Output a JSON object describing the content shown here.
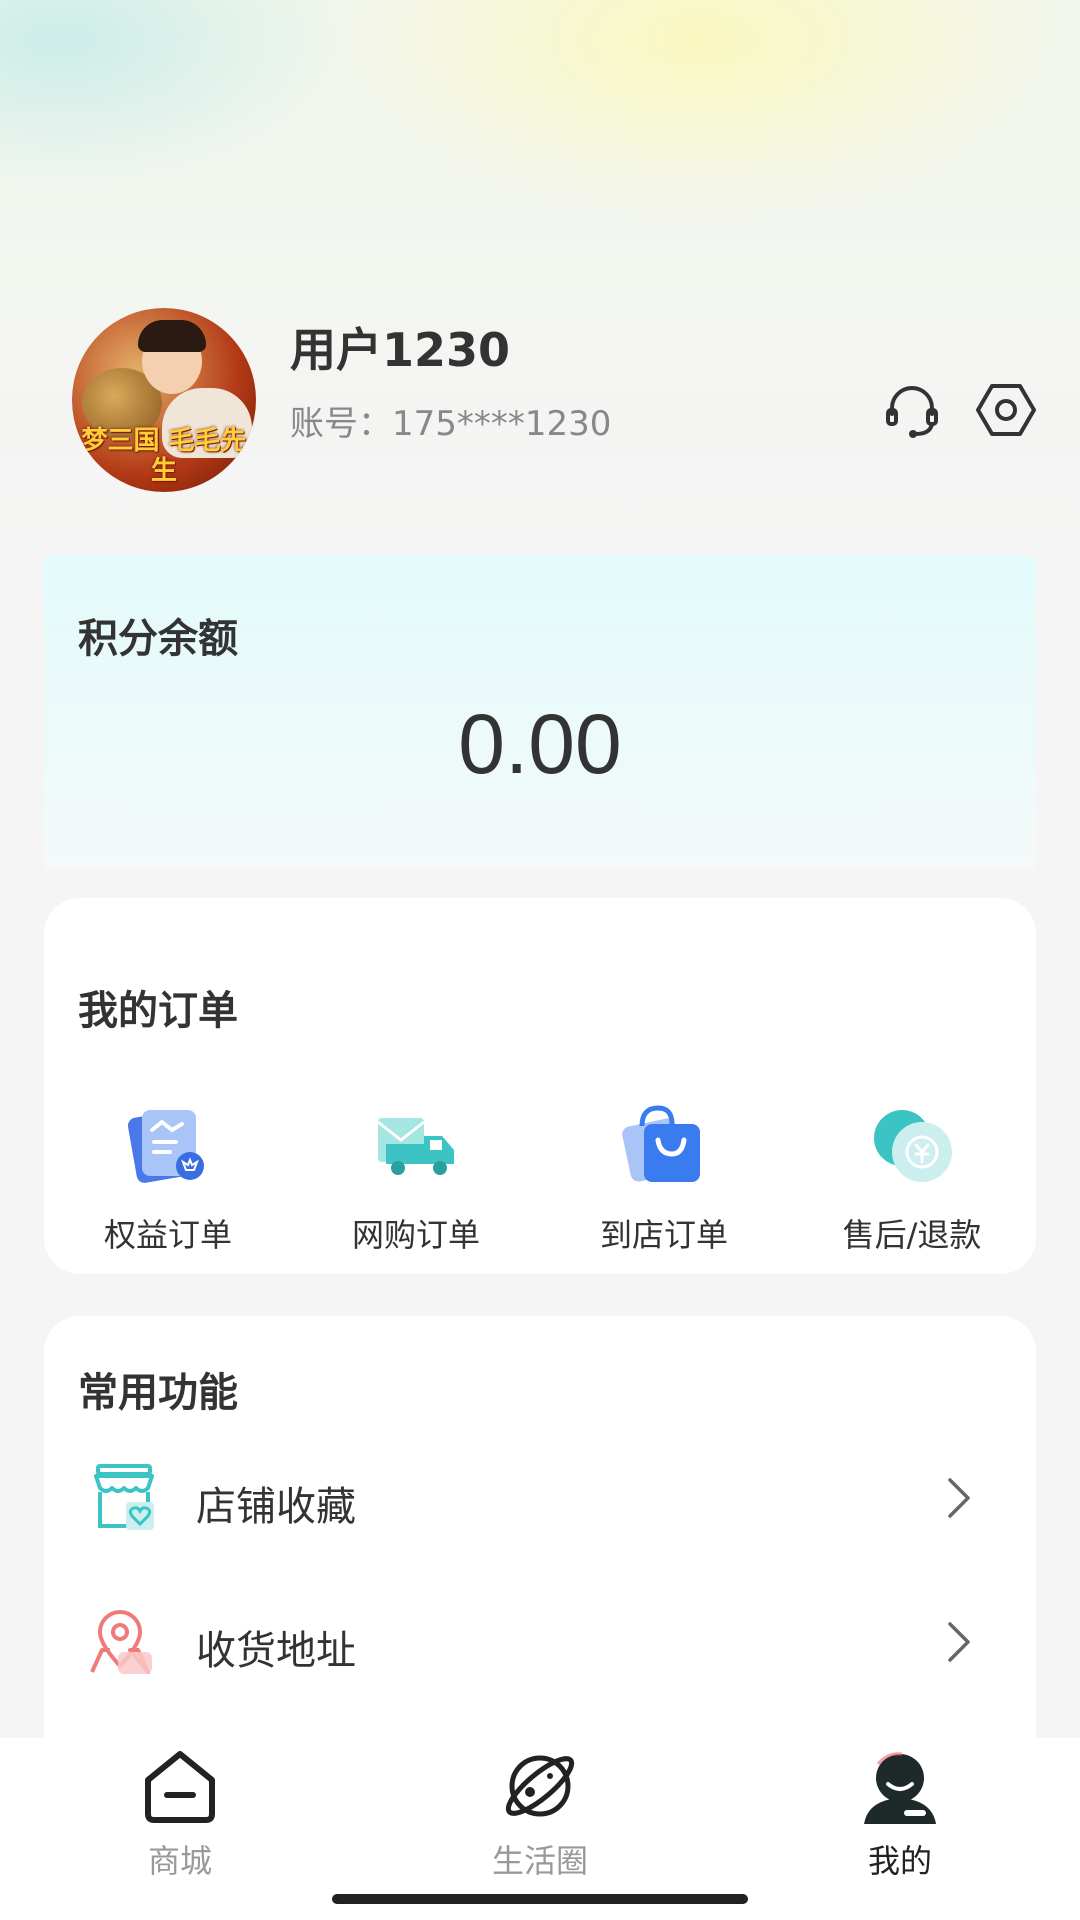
{
  "profile": {
    "username": "用户1230",
    "account": "账号：175****1230",
    "avatar_text": "梦三国 毛毛先生",
    "icons": {
      "support": "headset-icon",
      "settings": "settings-icon"
    }
  },
  "points": {
    "title": "积分余额",
    "value": "0.00"
  },
  "orders": {
    "title": "我的订单",
    "items": [
      {
        "label": "权益订单",
        "icon": "rights-order-icon"
      },
      {
        "label": "网购订单",
        "icon": "delivery-truck-icon"
      },
      {
        "label": "到店订单",
        "icon": "shopping-bag-icon"
      },
      {
        "label": "售后/退款",
        "icon": "refund-coin-icon"
      }
    ]
  },
  "functions": {
    "title": "常用功能",
    "items": [
      {
        "label": "店铺收藏",
        "icon": "store-favorite-icon"
      },
      {
        "label": "收货地址",
        "icon": "location-pin-icon"
      }
    ]
  },
  "bottom_nav": {
    "items": [
      {
        "label": "商城",
        "icon": "home-icon"
      },
      {
        "label": "生活圈",
        "icon": "planet-icon"
      },
      {
        "label": "我的",
        "icon": "profile-icon",
        "active": true
      }
    ]
  },
  "colors": {
    "accent_teal": "#3cc4c4",
    "accent_blue": "#3a7cf0",
    "accent_red": "#f07a7a"
  }
}
